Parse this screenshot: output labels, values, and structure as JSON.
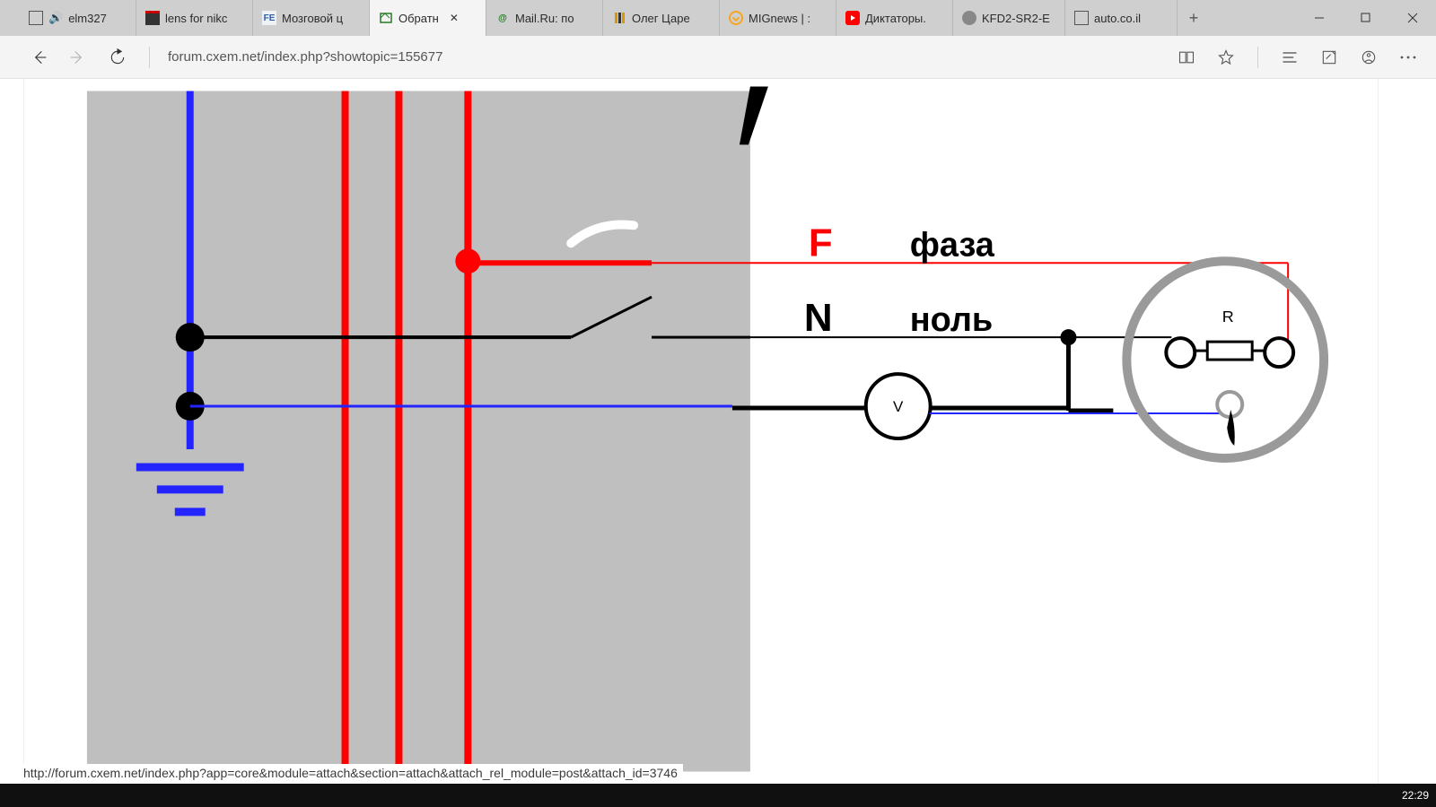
{
  "tabs": [
    {
      "label": "elm327"
    },
    {
      "label": "lens for nikc"
    },
    {
      "label": "Мозговой ц"
    },
    {
      "label": "Обратн",
      "active": true
    },
    {
      "label": "Mail.Ru: по"
    },
    {
      "label": "Олег Царе"
    },
    {
      "label": "MIGnews | :"
    },
    {
      "label": "Диктаторы."
    },
    {
      "label": "KFD2-SR2-E"
    },
    {
      "label": "auto.co.il"
    }
  ],
  "address": "forum.cxem.net/index.php?showtopic=155677",
  "status_url": "http://forum.cxem.net/index.php?app=core&module=attach&section=attach&attach_rel_module=post&attach_id=3746",
  "diagram": {
    "F": "F",
    "N": "N",
    "phase": "фаза",
    "neutral": "ноль",
    "V": "V",
    "R": "R"
  },
  "clock": "22:29"
}
